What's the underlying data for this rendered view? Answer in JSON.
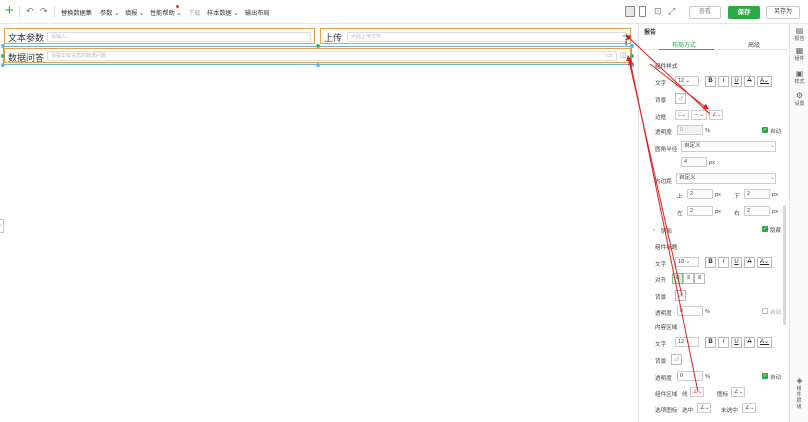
{
  "toolbar": {
    "menus": [
      "替换数据集",
      "参数",
      "填报",
      "性能帮助",
      "下载",
      "样本数据",
      "输出布局"
    ],
    "preview": "查看",
    "save": "保存",
    "save_as": "另存为"
  },
  "canvas": {
    "c1_label": "文本参数",
    "c1_placeholder": "请输入...",
    "c2_label": "上传",
    "c2_placeholder": "点此上传文件",
    "c3_label": "数据问答",
    "c3_placeholder": "请提出有关您的数据问题"
  },
  "panel": {
    "title": "报告",
    "tabs": [
      "布局方式",
      "高级"
    ],
    "s_comp_style": "组件样式",
    "text_label": "文字",
    "text_size": "12",
    "bg_label": "背景",
    "border_label": "边框",
    "opacity_label": "透明度",
    "opacity_val": "0",
    "pct": "%",
    "auto": "自动",
    "radius_label": "圆角半径",
    "radius_val": "自定义",
    "radius_num": "4",
    "px": "px",
    "padding_label": "内边距",
    "padding_val": "自定义",
    "pad_top_lbl": "上",
    "pad_top": "2",
    "pad_bottom_lbl": "下",
    "pad_bottom": "2",
    "pad_left_lbl": "左",
    "pad_left": "2",
    "pad_right_lbl": "右",
    "pad_right": "2",
    "shadow_label": "阴影",
    "hide": "隐藏",
    "s_comp_title": "组件标题",
    "title_size": "18",
    "align_label": "对齐",
    "s_content": "内容区域",
    "content_size": "12",
    "comp_area": "组件区域",
    "line": "线",
    "icon": "图标",
    "option_icon": "选项图标",
    "selected": "选中",
    "unselected": "未选中"
  },
  "rail": {
    "report": "报告",
    "component": "组件",
    "style": "样式",
    "settings": "设置",
    "layers": "组件层级"
  }
}
